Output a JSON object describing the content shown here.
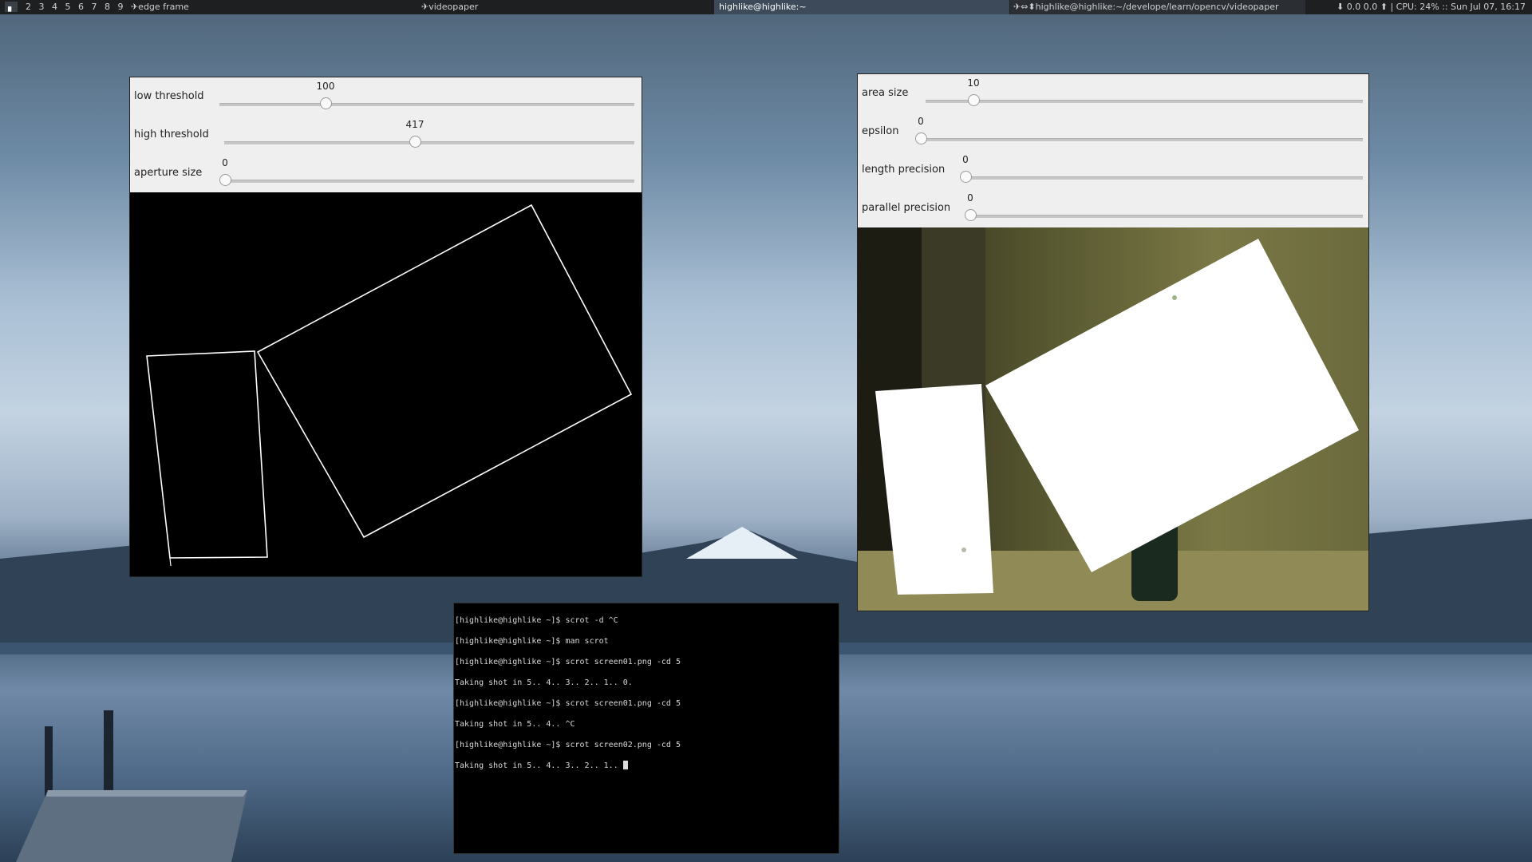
{
  "panel": {
    "workspaces": [
      "2",
      "3",
      "4",
      "5",
      "6",
      "7",
      "8",
      "9"
    ],
    "active_workspace_icon": "▖",
    "window_title_edge": "✈edge frame",
    "window_title_video": "✈videopaper",
    "window_title_terminal": "highlike@highlike:~",
    "window_title_path": "✈⇔⬍highlike@highlike:~/develope/learn/opencv/videopaper",
    "status_text": "0.0 0.0",
    "cpu": "CPU: 24%",
    "clock": "Sun Jul 07, 16:17"
  },
  "edge_window": {
    "trackbars": [
      {
        "label": "low threshold",
        "value": "100",
        "fraction": 0.256
      },
      {
        "label": "high threshold",
        "value": "417",
        "fraction": 0.463
      },
      {
        "label": "aperture size",
        "value": "0",
        "fraction": 0.0
      }
    ]
  },
  "video_window": {
    "trackbars": [
      {
        "label": "area size",
        "value": "10",
        "fraction": 0.11
      },
      {
        "label": "epsilon",
        "value": "0",
        "fraction": 0.0
      },
      {
        "label": "length precision",
        "value": "0",
        "fraction": 0.0
      },
      {
        "label": "parallel precision",
        "value": "0",
        "fraction": 0.0
      }
    ]
  },
  "terminal": {
    "lines": [
      "[highlike@highlike ~]$ scrot -d ^C",
      "[highlike@highlike ~]$ man scrot",
      "[highlike@highlike ~]$ scrot screen01.png -cd 5",
      "Taking shot in 5.. 4.. 3.. 2.. 1.. 0.",
      "[highlike@highlike ~]$ scrot screen01.png -cd 5",
      "Taking shot in 5.. 4.. ^C",
      "[highlike@highlike ~]$ scrot screen02.png -cd 5",
      "Taking shot in 5.. 4.. 3.. 2.. 1.. "
    ]
  }
}
